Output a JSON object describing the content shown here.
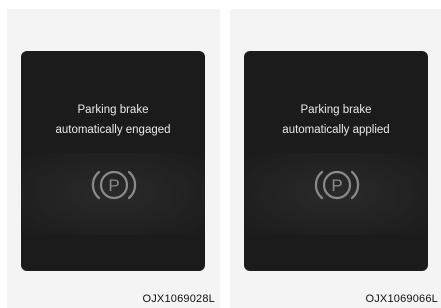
{
  "panels": [
    {
      "message_line1": "Parking brake",
      "message_line2": "automatically engaged",
      "icon": "parking-brake-icon",
      "icon_letter": "P",
      "code": "OJX1069028L"
    },
    {
      "message_line1": "Parking brake",
      "message_line2": "automatically applied",
      "icon": "parking-brake-icon",
      "icon_letter": "P",
      "code": "OJX1069066L"
    }
  ],
  "colors": {
    "screen_bg": "#1b1b1b",
    "text": "#e8e8e8",
    "icon": "#8a8a8a",
    "panel_bg": "#f4f4f4"
  }
}
